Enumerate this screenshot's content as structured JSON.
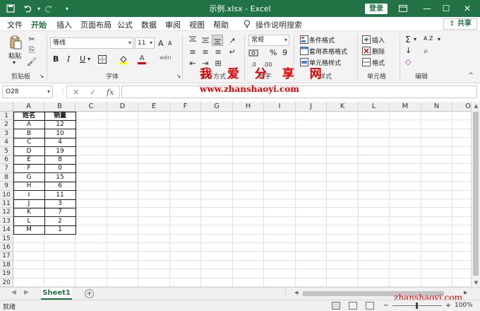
{
  "titlebar": {
    "title": "示例.xlsx  -  Excel",
    "login": "登录",
    "save_icon": "save-icon",
    "undo_icon": "undo-icon",
    "redo_icon": "redo-icon",
    "customize_icon": "chevron-down-icon",
    "ribbon_display_icon": "ribbon-display-icon",
    "minimize_glyph": "—",
    "maximize_glyph": "☐",
    "close_glyph": "✕"
  },
  "menu": {
    "tabs": [
      "文件",
      "开始",
      "插入",
      "页面布局",
      "公式",
      "数据",
      "审阅",
      "视图",
      "帮助"
    ],
    "active_tab": "开始",
    "search": "操作说明搜索",
    "share": "共享"
  },
  "ribbon": {
    "clipboard": {
      "paste": "粘贴",
      "label": "剪贴板"
    },
    "font": {
      "font_name": "等线",
      "font_size": "11",
      "bold": "B",
      "italic": "I",
      "underline": "U",
      "grow": "A",
      "shrink": "A",
      "font_color": "A",
      "phonetic": "wén",
      "label": "字体"
    },
    "alignment": {
      "label": "对齐方式"
    },
    "number": {
      "format": "常规",
      "percent": "%",
      "comma": "9",
      "label": "数字"
    },
    "styles": {
      "conditional": "条件格式",
      "table_format": "套用表格格式",
      "cell_styles": "单元格样式",
      "label": "样式"
    },
    "cells": {
      "insert": "插入",
      "delete": "删除",
      "format": "格式",
      "label": "单元格"
    },
    "editing": {
      "sum": "Σ",
      "sort": "A Z",
      "find": "⌕",
      "fill": "↓",
      "clear": "◇",
      "label": "编辑"
    }
  },
  "watermark": {
    "line1": "我 爱 分 享 网",
    "line2": "www.zhanshaoyi.com",
    "corner": "zhanshaoyi.com"
  },
  "formula_bar": {
    "name_box": "O28",
    "cancel": "✕",
    "enter": "✓",
    "fx": "fx",
    "value": ""
  },
  "grid": {
    "columns": [
      "A",
      "B",
      "C",
      "D",
      "E",
      "F",
      "G",
      "H",
      "I",
      "J",
      "K",
      "L",
      "M",
      "N",
      "O"
    ],
    "rows": [
      "1",
      "2",
      "3",
      "4",
      "5",
      "6",
      "7",
      "8",
      "9",
      "10",
      "11",
      "12",
      "13",
      "14",
      "15",
      "16",
      "17",
      "18",
      "19",
      "20"
    ],
    "headers": [
      "姓名",
      "销量"
    ],
    "data": [
      [
        "A",
        "12"
      ],
      [
        "B",
        "10"
      ],
      [
        "C",
        "4"
      ],
      [
        "D",
        "19"
      ],
      [
        "E",
        "8"
      ],
      [
        "F",
        "0"
      ],
      [
        "G",
        "15"
      ],
      [
        "H",
        "6"
      ],
      [
        "I",
        "11"
      ],
      [
        "J",
        "3"
      ],
      [
        "K",
        "7"
      ],
      [
        "L",
        "2"
      ],
      [
        "M",
        "1"
      ]
    ]
  },
  "sheets": {
    "tabs": [
      "Sheet1"
    ],
    "add": "+"
  },
  "status": {
    "ready": "就绪",
    "zoom": "100%"
  }
}
